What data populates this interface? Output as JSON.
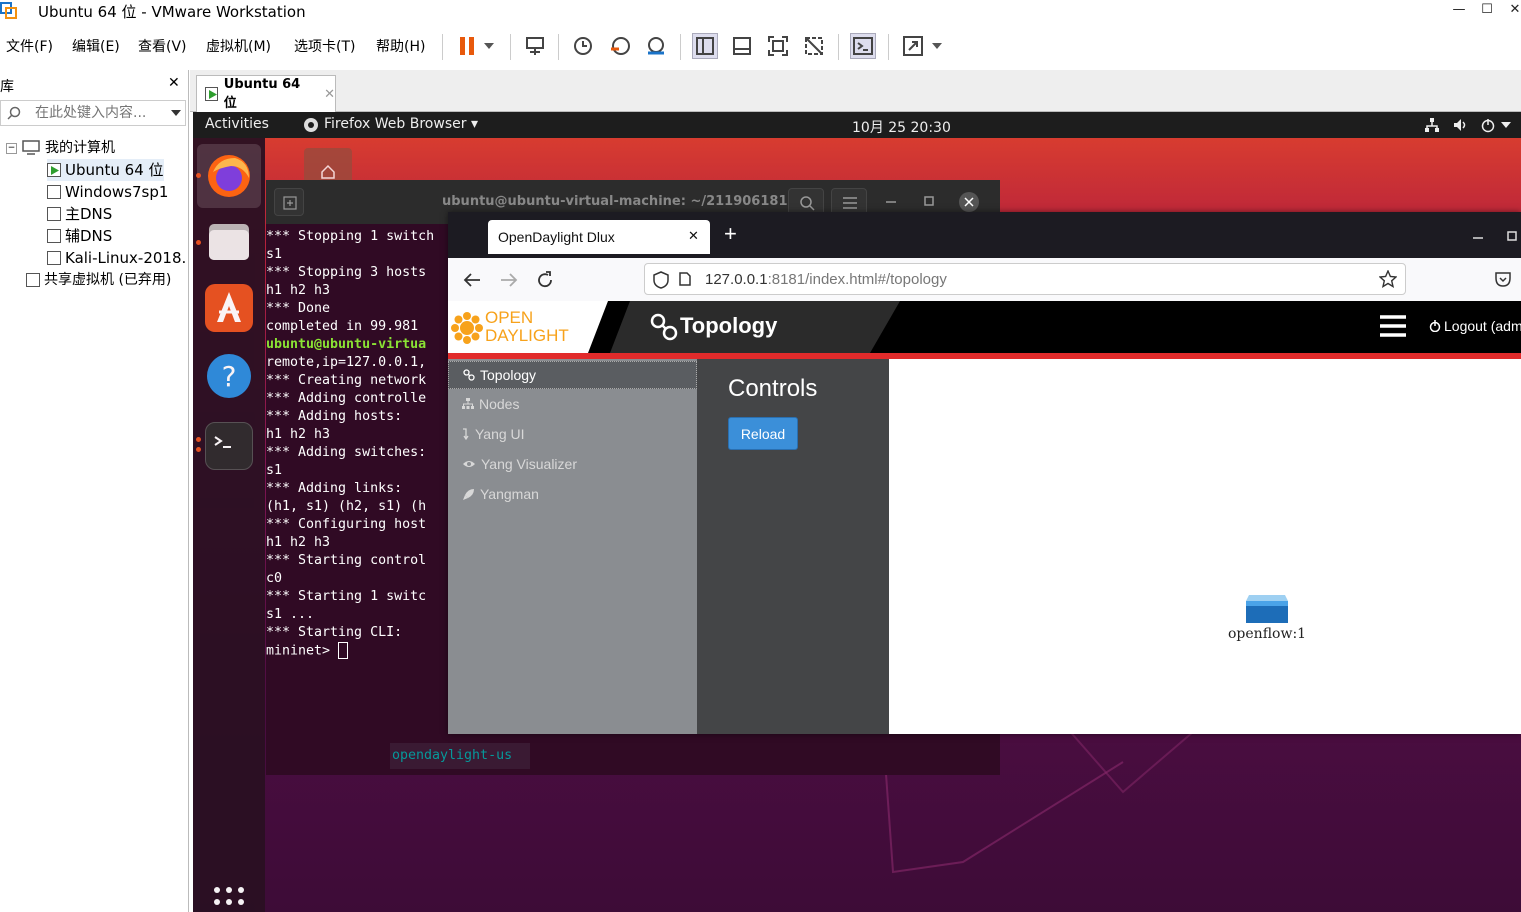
{
  "window": {
    "title": "Ubuntu 64 位 - VMware Workstation",
    "min": "—",
    "max": "☐",
    "close": "✕"
  },
  "menu": [
    "文件(F)",
    "编辑(E)",
    "查看(V)",
    "虚拟机(M)",
    "选项卡(T)",
    "帮助(H)"
  ],
  "library": {
    "title": "库",
    "close": "✕",
    "search_placeholder": "在此处键入内容...",
    "root": "我的计算机",
    "vms": [
      "Ubuntu 64 位",
      "Windows7sp1",
      "主DNS",
      "辅DNS",
      "Kali-Linux-2018."
    ],
    "shared": "共享虚拟机 (已弃用)"
  },
  "vm_tab": {
    "label": "Ubuntu 64 位",
    "close": "✕"
  },
  "gnome": {
    "activities": "Activities",
    "app": "Firefox Web Browser ▾",
    "clock": "10月 25  20:30"
  },
  "terminal": {
    "title": "ubuntu@ubuntu-virtual-machine: ~/211906181",
    "lines": [
      "*** Stopping 1 switch",
      "s1",
      "*** Stopping 3 hosts",
      "h1 h2 h3",
      "*** Done",
      "completed in 99.981",
      "ubuntu@ubuntu-virtua",
      "remote,ip=127.0.0.1,",
      "*** Creating network",
      "*** Adding controlle",
      "*** Adding hosts:",
      "h1 h2 h3",
      "*** Adding switches:",
      "s1",
      "*** Adding links:",
      "(h1, s1) (h2, s1) (h",
      "*** Configuring host",
      "h1 h2 h3",
      "*** Starting control",
      "c0",
      "*** Starting 1 switc",
      "s1 ...",
      "*** Starting CLI:",
      "mininet> "
    ],
    "bottom_text": "opendaylight-us"
  },
  "firefox": {
    "tab_title": "OpenDaylight Dlux",
    "tab_close": "✕",
    "new_tab": "+",
    "url_host": "127.0.0.1",
    "url_rest": ":8181/index.html#/topology"
  },
  "odl": {
    "logo_top": "OPEN",
    "logo_bottom": "DAYLIGHT",
    "page_title": "Topology",
    "logout": "Logout (adm",
    "sidebar": [
      "Topology",
      "Nodes",
      "Yang UI",
      "Yang Visualizer",
      "Yangman"
    ],
    "controls_title": "Controls",
    "reload": "Reload",
    "node_label": "openflow:1"
  },
  "colors": {
    "accent": "#e12b2b",
    "ubuntu_orange": "#e95420",
    "reload_blue": "#3b8fd9"
  }
}
